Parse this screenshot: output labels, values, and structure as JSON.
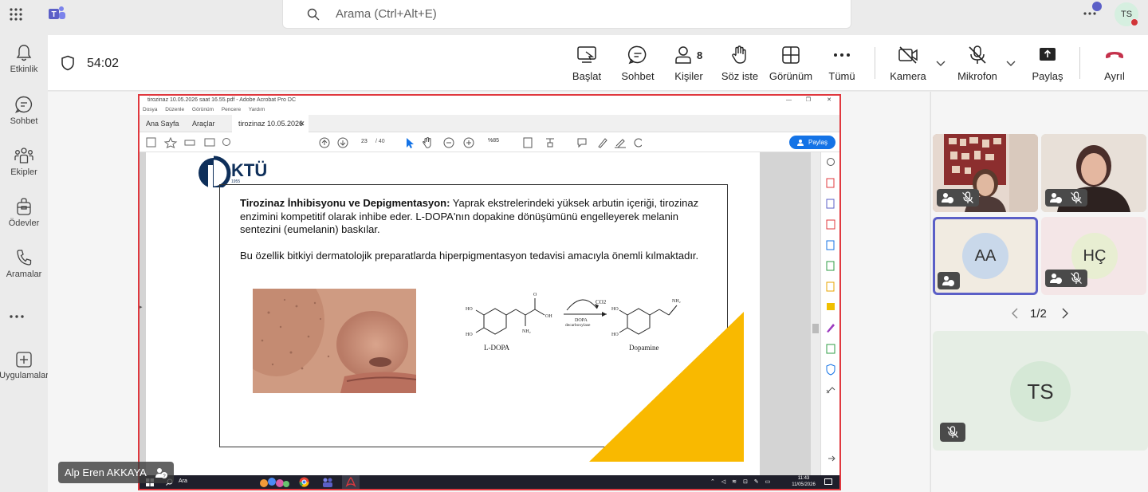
{
  "search": {
    "placeholder": "Arama (Ctrl+Alt+E)"
  },
  "profile": {
    "initials": "TS"
  },
  "rail": [
    {
      "label": "Etkinlik",
      "icon": "bell-icon"
    },
    {
      "label": "Sohbet",
      "icon": "chat-icon"
    },
    {
      "label": "Ekipler",
      "icon": "teams-icon"
    },
    {
      "label": "Ödevler",
      "icon": "backpack-icon"
    },
    {
      "label": "Aramalar",
      "icon": "phone-icon"
    },
    {
      "label": "Uygulamalar",
      "icon": "add-apps-icon"
    }
  ],
  "meeting": {
    "timer": "54:02",
    "toolbar": {
      "start": "Başlat",
      "chat": "Sohbet",
      "people": "Kişiler",
      "people_count": "8",
      "raise": "Söz iste",
      "view": "Görünüm",
      "more": "Tümü",
      "camera": "Kamera",
      "mic": "Mikrofon",
      "share": "Paylaş",
      "leave": "Ayrıl"
    }
  },
  "acrobat": {
    "title": "tirozinaz 10.05.2026 saat 16.55.pdf - Adobe Acrobat Pro DC",
    "menu": [
      "Dosya",
      "Düzenle",
      "Görünüm",
      "Pencere",
      "Yardım"
    ],
    "tabs": {
      "home": "Ana Sayfa",
      "tools": "Araçlar",
      "doc": "tirozinaz 10.05.2026 ..."
    },
    "page_current": "23",
    "page_total": "/ 40",
    "zoom": "%85",
    "share_button": "Paylaş"
  },
  "slide": {
    "logo_text": "KTÜ",
    "logo_year": "1955",
    "heading": "Tirozinaz İnhibisyonu ve Depigmentasyon:",
    "para1": " Yaprak ekstrelerindeki yüksek arbutin içeriği, tirozinaz enzimini kompetitif olarak inhibe eder. L-DOPA'nın dopakine dönüşümünü engelleyerek melanin sentezini (eumelanin) baskılar.",
    "para2": "Bu özellik bitkiyi dermatolojik preparatlarda hiperpigmentasyon tedavisi amacıyla önemli kılmaktadır.",
    "chem": {
      "ldopa": "L-DOPA",
      "dopamine": "Dopamine",
      "co2": "CO2",
      "enzyme_line1": "DOPA",
      "enzyme_line2": "decarboxylase",
      "ho": "HO",
      "oh": "OH",
      "nh2": "NH₂",
      "o": "O"
    }
  },
  "taskbar": {
    "search": "Ara",
    "time": "11:43",
    "date": "11/05/2026"
  },
  "presenter": {
    "name": "Alp Eren AKKAYA"
  },
  "participants": {
    "aa": "AA",
    "hc": "HÇ",
    "ts": "TS",
    "pager": "1/2"
  }
}
